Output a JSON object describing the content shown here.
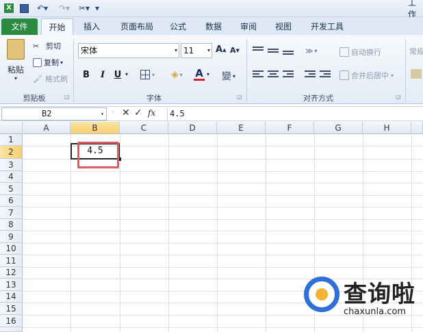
{
  "window": {
    "title_partial": "工作"
  },
  "tabs": [
    "文件",
    "开始",
    "插入",
    "页面布局",
    "公式",
    "数据",
    "审阅",
    "视图",
    "开发工具"
  ],
  "clipboard": {
    "paste": "粘贴",
    "cut": "剪切",
    "copy": "复制",
    "format_painter": "格式刷",
    "group": "剪贴板"
  },
  "font": {
    "name": "宋体",
    "size": "11",
    "group": "字体",
    "bold": "B",
    "italic": "I",
    "underline": "U",
    "color_letter": "A",
    "wen": "變"
  },
  "alignment": {
    "wrap": "自动换行",
    "merge": "合并后居中",
    "group": "对齐方式"
  },
  "number": {
    "format_partial": "常规"
  },
  "formula_bar": {
    "cell_ref": "B2",
    "fx": "fx",
    "cancel": "✕",
    "confirm": "✓",
    "value": "4.5"
  },
  "columns": [
    "A",
    "B",
    "C",
    "D",
    "E",
    "F",
    "G",
    "H"
  ],
  "rows": [
    "1",
    "2",
    "3",
    "4",
    "5",
    "6",
    "7",
    "8",
    "9",
    "10",
    "11",
    "12",
    "13",
    "14",
    "15",
    "16"
  ],
  "cells": {
    "B2": "4.5"
  },
  "selected": {
    "column": "B",
    "row": "2"
  },
  "watermark": {
    "title": "查询啦",
    "url": "chaxunla.com"
  },
  "colors": {
    "file_tab": "#2a8a3f",
    "selection_header": "#f7cf6e",
    "highlight_box": "#e05a61",
    "watermark_blue": "#2f6fd8",
    "watermark_orange": "#f5b335"
  }
}
